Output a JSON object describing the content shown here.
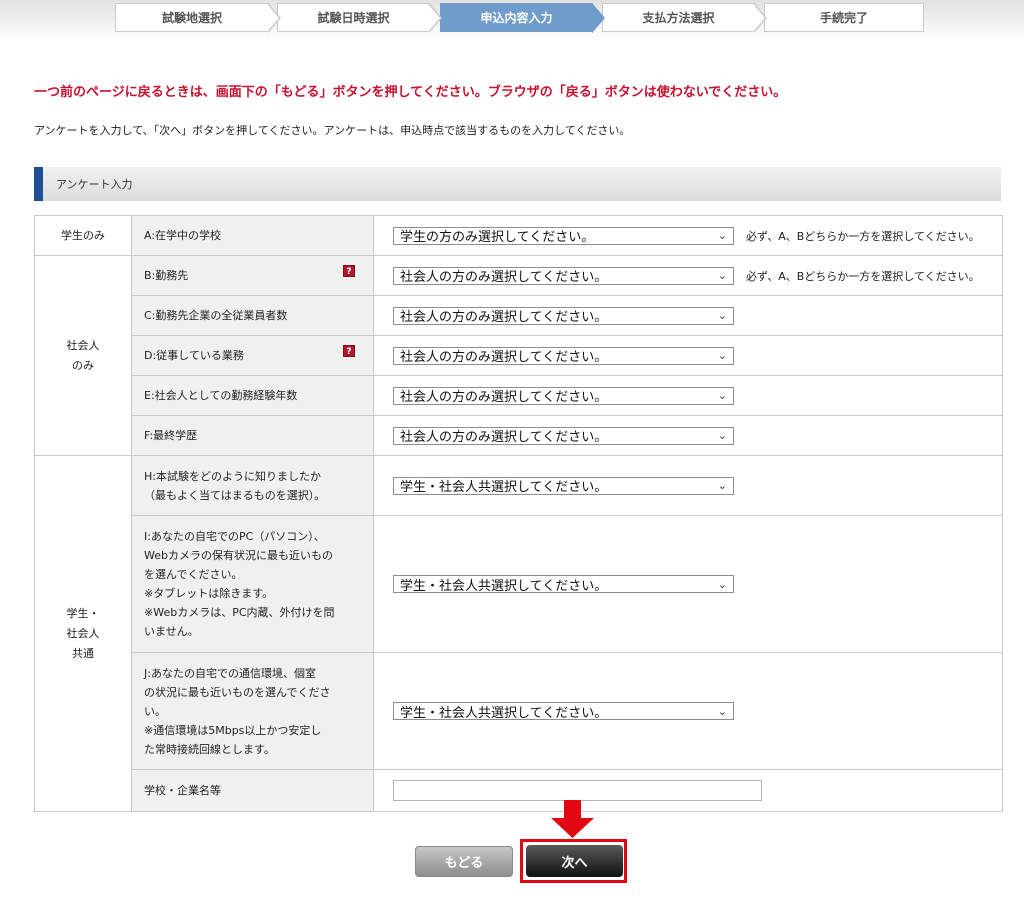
{
  "steps": [
    {
      "label": "試験地選択",
      "active": false
    },
    {
      "label": "試験日時選択",
      "active": false
    },
    {
      "label": "申込内容入力",
      "active": true
    },
    {
      "label": "支払方法選択",
      "active": false
    },
    {
      "label": "手続完了",
      "active": false
    }
  ],
  "warning": "一つ前のページに戻るときは、画面下の「もどる」ボタンを押してください。ブラウザの「戻る」ボタンは使わないでください。",
  "instruction": "アンケートを入力して、「次へ」ボタンを押してください。アンケートは、申込時点で該当するものを入力してください。",
  "section_title": "アンケート入力",
  "groups": {
    "student": "学生のみ",
    "worker_line1": "社会人",
    "worker_line2": "のみ",
    "common_line1": "学生・",
    "common_line2": "社会人",
    "common_line3": "共通"
  },
  "rows": {
    "a": {
      "label": "A:在学中の学校",
      "value": "学生の方のみ選択してください。",
      "note": "必ず、A、Bどちらか一方を選択してください。"
    },
    "b": {
      "label": "B:勤務先",
      "value": "社会人の方のみ選択してください。",
      "note": "必ず、A、Bどちらか一方を選択してください。"
    },
    "c": {
      "label": "C:勤務先企業の全従業員者数",
      "value": "社会人の方のみ選択してください。"
    },
    "d": {
      "label": "D:従事している業務",
      "value": "社会人の方のみ選択してください。"
    },
    "e": {
      "label": "E:社会人としての勤務経験年数",
      "value": "社会人の方のみ選択してください。"
    },
    "f": {
      "label": "F:最終学歴",
      "value": "社会人の方のみ選択してください。"
    },
    "h": {
      "label_1": "H:本試験をどのように知りましたか",
      "label_2": "（最もよく当てはまるものを選択）。",
      "value": "学生・社会人共選択してください。"
    },
    "i": {
      "label_1": "I:あなたの自宅でのPC（パソコン）、",
      "label_2": "Webカメラの保有状況に最も近いもの",
      "label_3": "を選んでください。",
      "label_4": "※タブレットは除きます。",
      "label_5": "※Webカメラは、PC内蔵、外付けを問",
      "label_6": "いません。",
      "value": "学生・社会人共選択してください。"
    },
    "j": {
      "label_1": "J:あなたの自宅での通信環境、個室",
      "label_2": "の状況に最も近いものを選んでくださ",
      "label_3": "い。",
      "label_4": "※通信環境は5Mbps以上かつ安定し",
      "label_5": "た常時接続回線とします。",
      "value": "学生・社会人共選択してください。"
    },
    "school": {
      "label": "学校・企業名等",
      "value": ""
    }
  },
  "help_glyph": "?",
  "buttons": {
    "back": "もどる",
    "next": "次へ"
  },
  "colors": {
    "warning": "#c8102e",
    "active_step": "#6f9ccb",
    "highlight": "#e30613"
  }
}
